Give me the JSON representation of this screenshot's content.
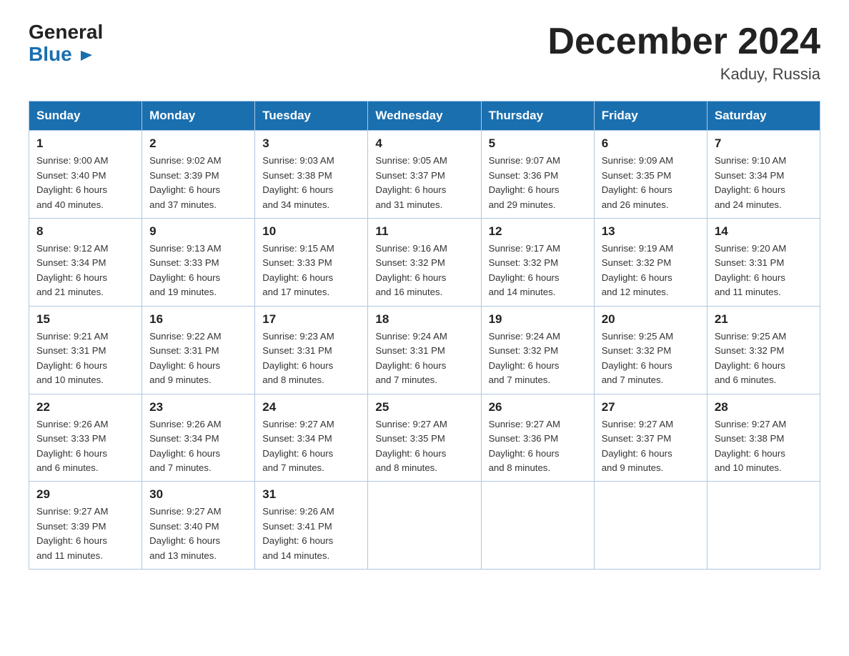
{
  "header": {
    "logo_general": "General",
    "logo_blue": "Blue",
    "month_title": "December 2024",
    "location": "Kaduy, Russia"
  },
  "weekdays": [
    "Sunday",
    "Monday",
    "Tuesday",
    "Wednesday",
    "Thursday",
    "Friday",
    "Saturday"
  ],
  "weeks": [
    [
      {
        "day": "1",
        "sunrise": "9:00 AM",
        "sunset": "3:40 PM",
        "daylight": "6 hours and 40 minutes."
      },
      {
        "day": "2",
        "sunrise": "9:02 AM",
        "sunset": "3:39 PM",
        "daylight": "6 hours and 37 minutes."
      },
      {
        "day": "3",
        "sunrise": "9:03 AM",
        "sunset": "3:38 PM",
        "daylight": "6 hours and 34 minutes."
      },
      {
        "day": "4",
        "sunrise": "9:05 AM",
        "sunset": "3:37 PM",
        "daylight": "6 hours and 31 minutes."
      },
      {
        "day": "5",
        "sunrise": "9:07 AM",
        "sunset": "3:36 PM",
        "daylight": "6 hours and 29 minutes."
      },
      {
        "day": "6",
        "sunrise": "9:09 AM",
        "sunset": "3:35 PM",
        "daylight": "6 hours and 26 minutes."
      },
      {
        "day": "7",
        "sunrise": "9:10 AM",
        "sunset": "3:34 PM",
        "daylight": "6 hours and 24 minutes."
      }
    ],
    [
      {
        "day": "8",
        "sunrise": "9:12 AM",
        "sunset": "3:34 PM",
        "daylight": "6 hours and 21 minutes."
      },
      {
        "day": "9",
        "sunrise": "9:13 AM",
        "sunset": "3:33 PM",
        "daylight": "6 hours and 19 minutes."
      },
      {
        "day": "10",
        "sunrise": "9:15 AM",
        "sunset": "3:33 PM",
        "daylight": "6 hours and 17 minutes."
      },
      {
        "day": "11",
        "sunrise": "9:16 AM",
        "sunset": "3:32 PM",
        "daylight": "6 hours and 16 minutes."
      },
      {
        "day": "12",
        "sunrise": "9:17 AM",
        "sunset": "3:32 PM",
        "daylight": "6 hours and 14 minutes."
      },
      {
        "day": "13",
        "sunrise": "9:19 AM",
        "sunset": "3:32 PM",
        "daylight": "6 hours and 12 minutes."
      },
      {
        "day": "14",
        "sunrise": "9:20 AM",
        "sunset": "3:31 PM",
        "daylight": "6 hours and 11 minutes."
      }
    ],
    [
      {
        "day": "15",
        "sunrise": "9:21 AM",
        "sunset": "3:31 PM",
        "daylight": "6 hours and 10 minutes."
      },
      {
        "day": "16",
        "sunrise": "9:22 AM",
        "sunset": "3:31 PM",
        "daylight": "6 hours and 9 minutes."
      },
      {
        "day": "17",
        "sunrise": "9:23 AM",
        "sunset": "3:31 PM",
        "daylight": "6 hours and 8 minutes."
      },
      {
        "day": "18",
        "sunrise": "9:24 AM",
        "sunset": "3:31 PM",
        "daylight": "6 hours and 7 minutes."
      },
      {
        "day": "19",
        "sunrise": "9:24 AM",
        "sunset": "3:32 PM",
        "daylight": "6 hours and 7 minutes."
      },
      {
        "day": "20",
        "sunrise": "9:25 AM",
        "sunset": "3:32 PM",
        "daylight": "6 hours and 7 minutes."
      },
      {
        "day": "21",
        "sunrise": "9:25 AM",
        "sunset": "3:32 PM",
        "daylight": "6 hours and 6 minutes."
      }
    ],
    [
      {
        "day": "22",
        "sunrise": "9:26 AM",
        "sunset": "3:33 PM",
        "daylight": "6 hours and 6 minutes."
      },
      {
        "day": "23",
        "sunrise": "9:26 AM",
        "sunset": "3:34 PM",
        "daylight": "6 hours and 7 minutes."
      },
      {
        "day": "24",
        "sunrise": "9:27 AM",
        "sunset": "3:34 PM",
        "daylight": "6 hours and 7 minutes."
      },
      {
        "day": "25",
        "sunrise": "9:27 AM",
        "sunset": "3:35 PM",
        "daylight": "6 hours and 8 minutes."
      },
      {
        "day": "26",
        "sunrise": "9:27 AM",
        "sunset": "3:36 PM",
        "daylight": "6 hours and 8 minutes."
      },
      {
        "day": "27",
        "sunrise": "9:27 AM",
        "sunset": "3:37 PM",
        "daylight": "6 hours and 9 minutes."
      },
      {
        "day": "28",
        "sunrise": "9:27 AM",
        "sunset": "3:38 PM",
        "daylight": "6 hours and 10 minutes."
      }
    ],
    [
      {
        "day": "29",
        "sunrise": "9:27 AM",
        "sunset": "3:39 PM",
        "daylight": "6 hours and 11 minutes."
      },
      {
        "day": "30",
        "sunrise": "9:27 AM",
        "sunset": "3:40 PM",
        "daylight": "6 hours and 13 minutes."
      },
      {
        "day": "31",
        "sunrise": "9:26 AM",
        "sunset": "3:41 PM",
        "daylight": "6 hours and 14 minutes."
      },
      null,
      null,
      null,
      null
    ]
  ],
  "labels": {
    "sunrise": "Sunrise:",
    "sunset": "Sunset:",
    "daylight": "Daylight:"
  }
}
